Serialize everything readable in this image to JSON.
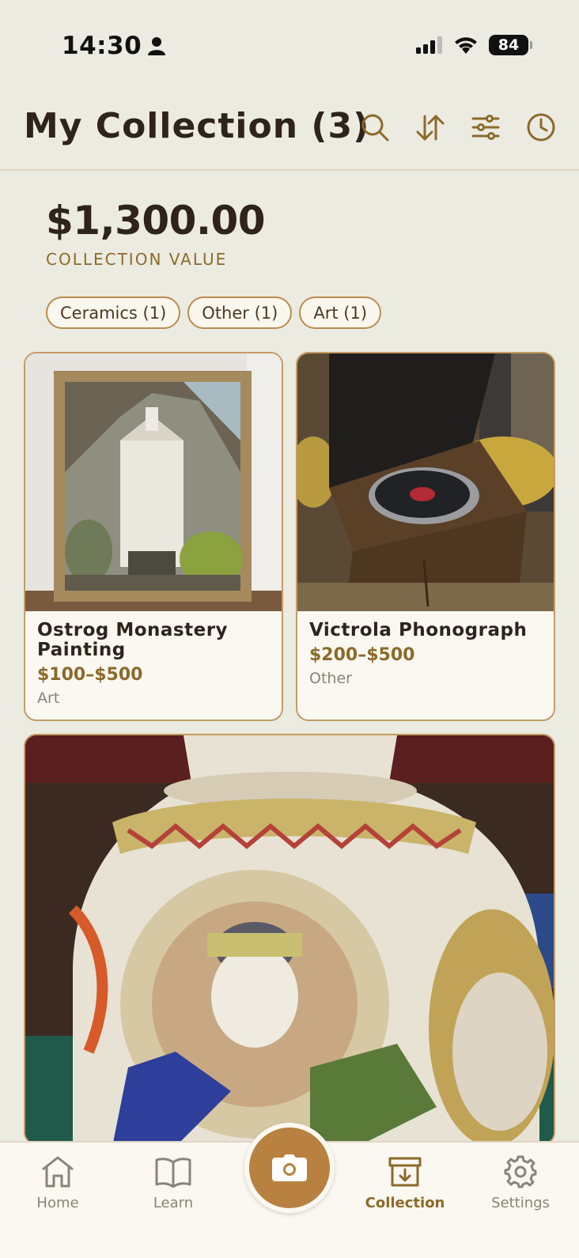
{
  "status": {
    "time": "14:30",
    "battery": "84"
  },
  "header": {
    "title": "My Collection (3)",
    "icons": [
      "search-icon",
      "sort-icon",
      "filter-icon",
      "history-icon"
    ]
  },
  "summary": {
    "amount": "$1,300.00",
    "label": "COLLECTION VALUE"
  },
  "chips": [
    "Ceramics (1)",
    "Other (1)",
    "Art (1)"
  ],
  "items": [
    {
      "title": "Ostrog Monastery Painting",
      "price": "$100–$500",
      "category": "Art"
    },
    {
      "title": "Victrola Phonograph",
      "price": "$200–$500",
      "category": "Other"
    }
  ],
  "nav": {
    "home": "Home",
    "learn": "Learn",
    "collection": "Collection",
    "settings": "Settings"
  },
  "colors": {
    "accent": "#b8813f",
    "brand_text": "#8c6a2a",
    "background": "#ecebe1",
    "card": "#faf8f1"
  }
}
